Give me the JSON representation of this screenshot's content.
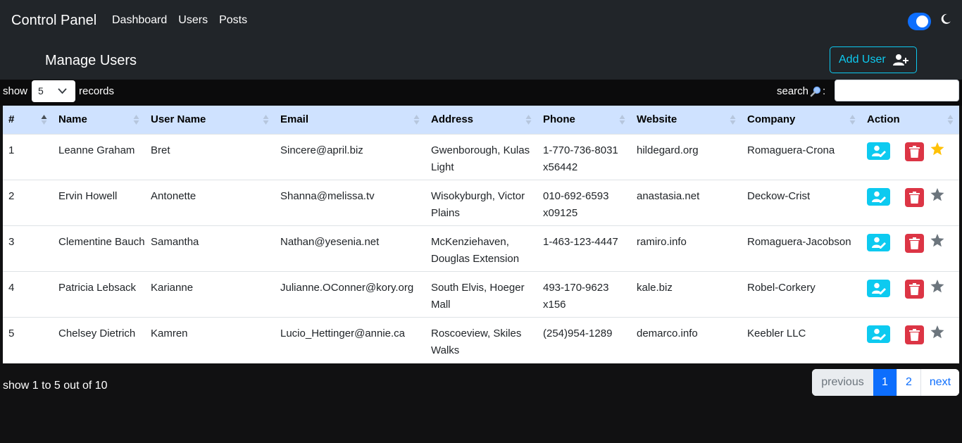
{
  "navbar": {
    "brand": "Control Panel",
    "links": [
      "Dashboard",
      "Users",
      "Posts"
    ]
  },
  "page_title": "Manage Users",
  "add_user_label": "Add User",
  "controls": {
    "show_label": "show",
    "page_size": "5",
    "records_label": "records",
    "search_label": "search",
    "search_colon": ":"
  },
  "table": {
    "columns": [
      "#",
      "Name",
      "User Name",
      "Email",
      "Address",
      "Phone",
      "Website",
      "Company",
      "Action"
    ],
    "rows": [
      {
        "id": "1",
        "name": "Leanne Graham",
        "username": "Bret",
        "email": "Sincere@april.biz",
        "address": "Gwenborough, Kulas Light",
        "phone": "1-770-736-8031 x56442",
        "website": "hildegard.org",
        "company": "Romaguera-Crona",
        "favorite": true
      },
      {
        "id": "2",
        "name": "Ervin Howell",
        "username": "Antonette",
        "email": "Shanna@melissa.tv",
        "address": "Wisokyburgh, Victor Plains",
        "phone": "010-692-6593 x09125",
        "website": "anastasia.net",
        "company": "Deckow-Crist",
        "favorite": false
      },
      {
        "id": "3",
        "name": "Clementine Bauch",
        "username": "Samantha",
        "email": "Nathan@yesenia.net",
        "address": "McKenziehaven, Douglas Extension",
        "phone": "1-463-123-4447",
        "website": "ramiro.info",
        "company": "Romaguera-Jacobson",
        "favorite": false
      },
      {
        "id": "4",
        "name": "Patricia Lebsack",
        "username": "Karianne",
        "email": "Julianne.OConner@kory.org",
        "address": "South Elvis, Hoeger Mall",
        "phone": "493-170-9623 x156",
        "website": "kale.biz",
        "company": "Robel-Corkery",
        "favorite": false
      },
      {
        "id": "5",
        "name": "Chelsey Dietrich",
        "username": "Kamren",
        "email": "Lucio_Hettinger@annie.ca",
        "address": "Roscoeview, Skiles Walks",
        "phone": "(254)954-1289",
        "website": "demarco.info",
        "company": "Keebler LLC",
        "favorite": false
      }
    ]
  },
  "footer": {
    "summary": "show 1 to 5 out of 10"
  },
  "pagination": {
    "previous": "previous",
    "pages": [
      "1",
      "2"
    ],
    "active_page": "1",
    "next": "next"
  },
  "colors": {
    "navbar_bg": "#212529",
    "accent_blue": "#0d6efd",
    "info_cyan": "#0dcaf0",
    "danger_red": "#dc3545",
    "header_row_bg": "#cfe2ff",
    "star_active": "#ffc107",
    "star_inactive": "#6c757d"
  },
  "icons": {
    "theme_toggle": "toggle-switch",
    "dark_mode": "moon-icon",
    "add_user": "user-plus-icon",
    "search": "magnifier-icon",
    "edit": "user-edit-icon",
    "delete": "trash-icon",
    "favorite": "star-icon"
  }
}
